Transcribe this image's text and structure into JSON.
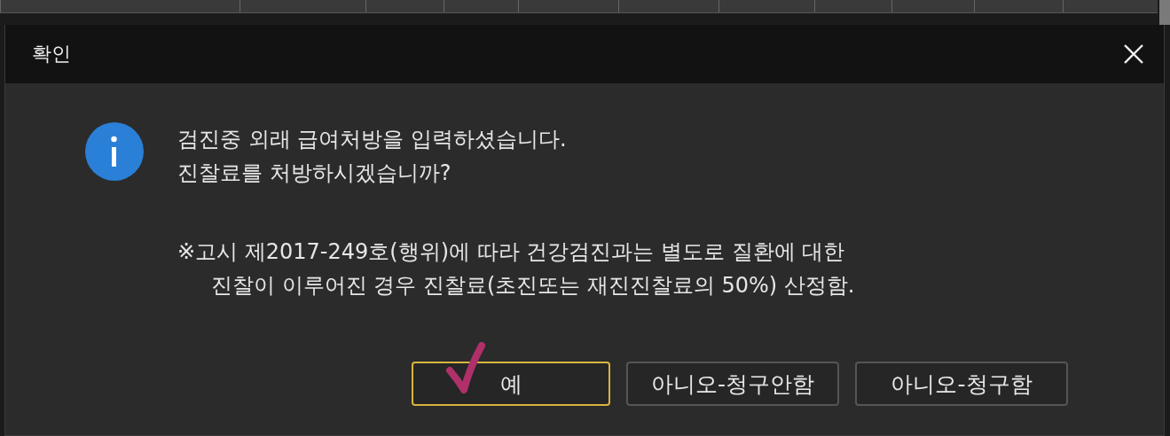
{
  "window": {
    "title": "확인"
  },
  "message": {
    "lines": [
      "검진중 외래 급여처방을 입력하셨습니다.",
      "진찰료를 처방하시겠습니까?"
    ]
  },
  "notice": {
    "lines": [
      "※고시 제2017-249호(행위)에 따라 건강검진과는 별도로 질환에 대한",
      "진찰이 이루어진 경우 진찰료(초진또는 재진진찰료의 50%) 산정함."
    ]
  },
  "buttons": [
    {
      "label": "예",
      "selected": true
    },
    {
      "label": "아니오-청구안함",
      "selected": false
    },
    {
      "label": "아니오-청구함",
      "selected": false
    }
  ]
}
